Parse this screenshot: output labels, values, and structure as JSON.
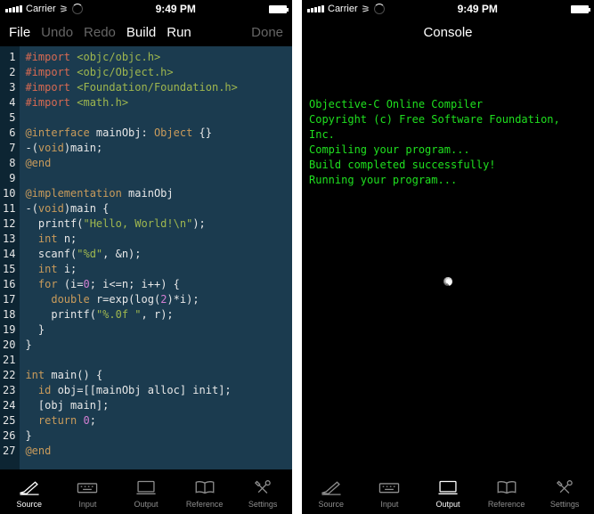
{
  "status": {
    "carrier": "Carrier",
    "time": "9:49 PM"
  },
  "left": {
    "toolbar": {
      "file": "File",
      "undo": "Undo",
      "redo": "Redo",
      "build": "Build",
      "run": "Run",
      "done": "Done"
    },
    "code": {
      "lines": [
        {
          "segs": [
            {
              "t": "#import ",
              "c": "c-preproc"
            },
            {
              "t": "<objc/objc.h>",
              "c": "c-string"
            }
          ]
        },
        {
          "segs": [
            {
              "t": "#import ",
              "c": "c-preproc"
            },
            {
              "t": "<objc/Object.h>",
              "c": "c-string"
            }
          ]
        },
        {
          "segs": [
            {
              "t": "#import ",
              "c": "c-preproc"
            },
            {
              "t": "<Foundation/Foundation.h>",
              "c": "c-string"
            }
          ]
        },
        {
          "segs": [
            {
              "t": "#import ",
              "c": "c-preproc"
            },
            {
              "t": "<math.h>",
              "c": "c-string"
            }
          ]
        },
        {
          "segs": [
            {
              "t": ""
            }
          ]
        },
        {
          "segs": [
            {
              "t": "@interface",
              "c": "c-keyword"
            },
            {
              "t": " mainObj: "
            },
            {
              "t": "Object",
              "c": "c-class"
            },
            {
              "t": " {}"
            }
          ]
        },
        {
          "segs": [
            {
              "t": "-"
            },
            {
              "t": "(",
              "c": ""
            },
            {
              "t": "void",
              "c": "c-type"
            },
            {
              "t": ")main;"
            }
          ]
        },
        {
          "segs": [
            {
              "t": "@end",
              "c": "c-keyword"
            }
          ]
        },
        {
          "segs": [
            {
              "t": ""
            }
          ]
        },
        {
          "segs": [
            {
              "t": "@implementation",
              "c": "c-keyword"
            },
            {
              "t": " mainObj"
            }
          ]
        },
        {
          "segs": [
            {
              "t": "-"
            },
            {
              "t": "("
            },
            {
              "t": "void",
              "c": "c-type"
            },
            {
              "t": ")main {"
            }
          ]
        },
        {
          "segs": [
            {
              "t": "  printf("
            },
            {
              "t": "\"Hello, World!\\n\"",
              "c": "c-string"
            },
            {
              "t": ");"
            }
          ]
        },
        {
          "segs": [
            {
              "t": "  "
            },
            {
              "t": "int",
              "c": "c-type"
            },
            {
              "t": " n;"
            }
          ]
        },
        {
          "segs": [
            {
              "t": "  scanf("
            },
            {
              "t": "\"%d\"",
              "c": "c-string"
            },
            {
              "t": ", &n);"
            }
          ]
        },
        {
          "segs": [
            {
              "t": "  "
            },
            {
              "t": "int",
              "c": "c-type"
            },
            {
              "t": " i;"
            }
          ]
        },
        {
          "segs": [
            {
              "t": "  "
            },
            {
              "t": "for",
              "c": "c-keyword"
            },
            {
              "t": " (i="
            },
            {
              "t": "0",
              "c": "c-num"
            },
            {
              "t": "; i<=n; i++) {"
            }
          ]
        },
        {
          "segs": [
            {
              "t": "    "
            },
            {
              "t": "double",
              "c": "c-type"
            },
            {
              "t": " r=exp(log("
            },
            {
              "t": "2",
              "c": "c-num"
            },
            {
              "t": ")*i);"
            }
          ]
        },
        {
          "segs": [
            {
              "t": "    printf("
            },
            {
              "t": "\"%.0f \"",
              "c": "c-string"
            },
            {
              "t": ", r);"
            }
          ]
        },
        {
          "segs": [
            {
              "t": "  }"
            }
          ]
        },
        {
          "segs": [
            {
              "t": "}"
            }
          ]
        },
        {
          "segs": [
            {
              "t": ""
            }
          ]
        },
        {
          "segs": [
            {
              "t": "int",
              "c": "c-type"
            },
            {
              "t": " main() {"
            }
          ]
        },
        {
          "segs": [
            {
              "t": "  "
            },
            {
              "t": "id",
              "c": "c-type"
            },
            {
              "t": " obj=[[mainObj alloc] init];"
            }
          ]
        },
        {
          "segs": [
            {
              "t": "  [obj main];"
            }
          ]
        },
        {
          "segs": [
            {
              "t": "  "
            },
            {
              "t": "return",
              "c": "c-keyword"
            },
            {
              "t": " "
            },
            {
              "t": "0",
              "c": "c-num"
            },
            {
              "t": ";"
            }
          ]
        },
        {
          "segs": [
            {
              "t": "}"
            }
          ]
        },
        {
          "segs": [
            {
              "t": "@end",
              "c": "c-keyword"
            }
          ]
        }
      ]
    }
  },
  "right": {
    "title": "Console",
    "console_lines": [
      "Objective-C Online Compiler",
      "Copyright (c) Free Software Foundation, Inc.",
      "",
      "Compiling your program...",
      "Build completed successfully!",
      "Running your program..."
    ]
  },
  "tabbar": {
    "tabs": [
      {
        "id": "source",
        "label": "Source",
        "icon": "pen"
      },
      {
        "id": "input",
        "label": "Input",
        "icon": "keyboard"
      },
      {
        "id": "output",
        "label": "Output",
        "icon": "screen"
      },
      {
        "id": "reference",
        "label": "Reference",
        "icon": "book"
      },
      {
        "id": "settings",
        "label": "Settings",
        "icon": "tools"
      }
    ],
    "active_left": "source",
    "active_right": "output"
  }
}
